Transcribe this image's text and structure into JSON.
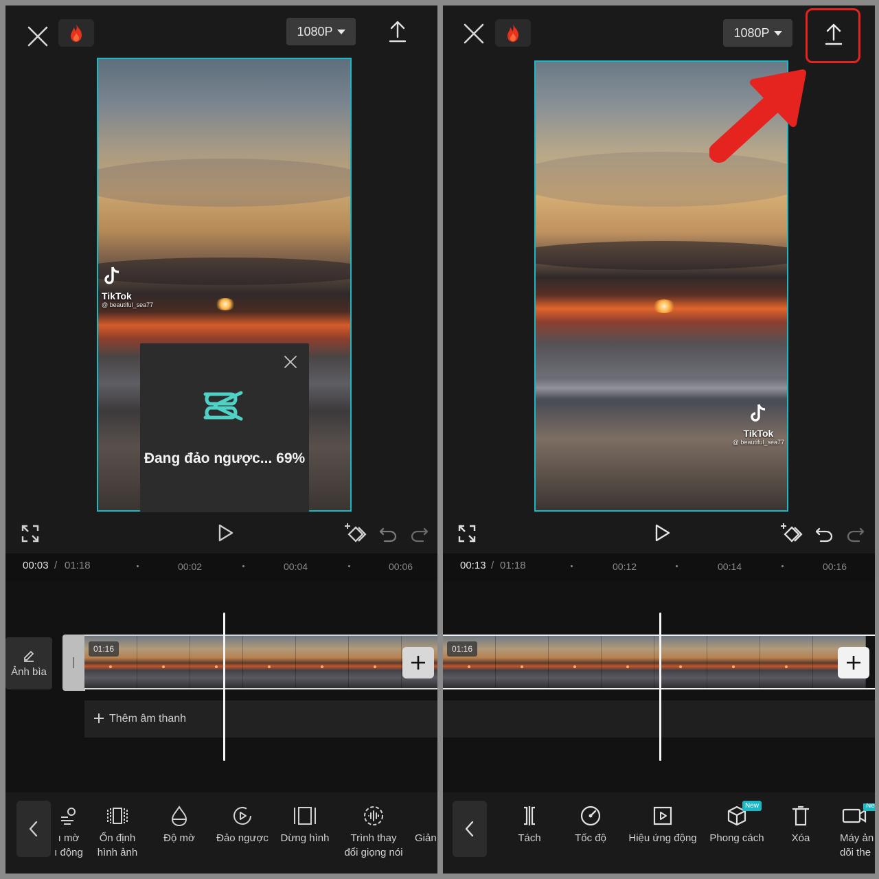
{
  "left_panel": {
    "resolution": "1080P",
    "watermark": {
      "name": "TikTok",
      "user": "@ beautiful_sea77"
    },
    "loading": {
      "text": "Đang đảo ngược... 69%"
    },
    "timecode": {
      "current": "00:03",
      "total": "01:18"
    },
    "ruler": [
      "00:02",
      "00:04",
      "00:06"
    ],
    "cover_label": "Ảnh bìa",
    "clip_duration": "01:16",
    "add_audio_label": "Thêm âm thanh",
    "tools": [
      {
        "line1": "ı mờ",
        "line2": "ı động",
        "icon": "blur-motion-icon"
      },
      {
        "line1": "Ổn định",
        "line2": "hình ảnh",
        "icon": "stabilize-icon"
      },
      {
        "line1": "Độ mờ",
        "line2": "",
        "icon": "opacity-drop-icon"
      },
      {
        "line1": "Đảo ngược",
        "line2": "",
        "icon": "reverse-icon"
      },
      {
        "line1": "Dừng hình",
        "line2": "",
        "icon": "freeze-frame-icon"
      },
      {
        "line1": "Trình thay",
        "line2": "đổi giọng nói",
        "icon": "voice-changer-icon"
      },
      {
        "line1": "Giản",
        "line2": "",
        "icon": ""
      }
    ]
  },
  "right_panel": {
    "resolution": "1080P",
    "watermark": {
      "name": "TikTok",
      "user": "@ beautiful_sea77"
    },
    "timecode": {
      "current": "00:13",
      "total": "01:18"
    },
    "ruler": [
      "00:12",
      "00:14",
      "00:16"
    ],
    "clip_duration": "01:16",
    "tools": [
      {
        "line1": "Tách",
        "line2": "",
        "icon": "split-icon"
      },
      {
        "line1": "Tốc độ",
        "line2": "",
        "icon": "speed-icon"
      },
      {
        "line1": "Hiệu ứng động",
        "line2": "",
        "icon": "animation-icon"
      },
      {
        "line1": "Phong cách",
        "line2": "",
        "icon": "style-cube-icon",
        "badge": "New"
      },
      {
        "line1": "Xóa",
        "line2": "",
        "icon": "delete-icon"
      },
      {
        "line1": "Máy ản",
        "line2": "dõi the",
        "icon": "camera-tracking-icon",
        "badge": "Ne"
      }
    ]
  },
  "colors": {
    "accent": "#1bb8c6",
    "highlight": "#e52420",
    "background": "#1a1a1a"
  }
}
